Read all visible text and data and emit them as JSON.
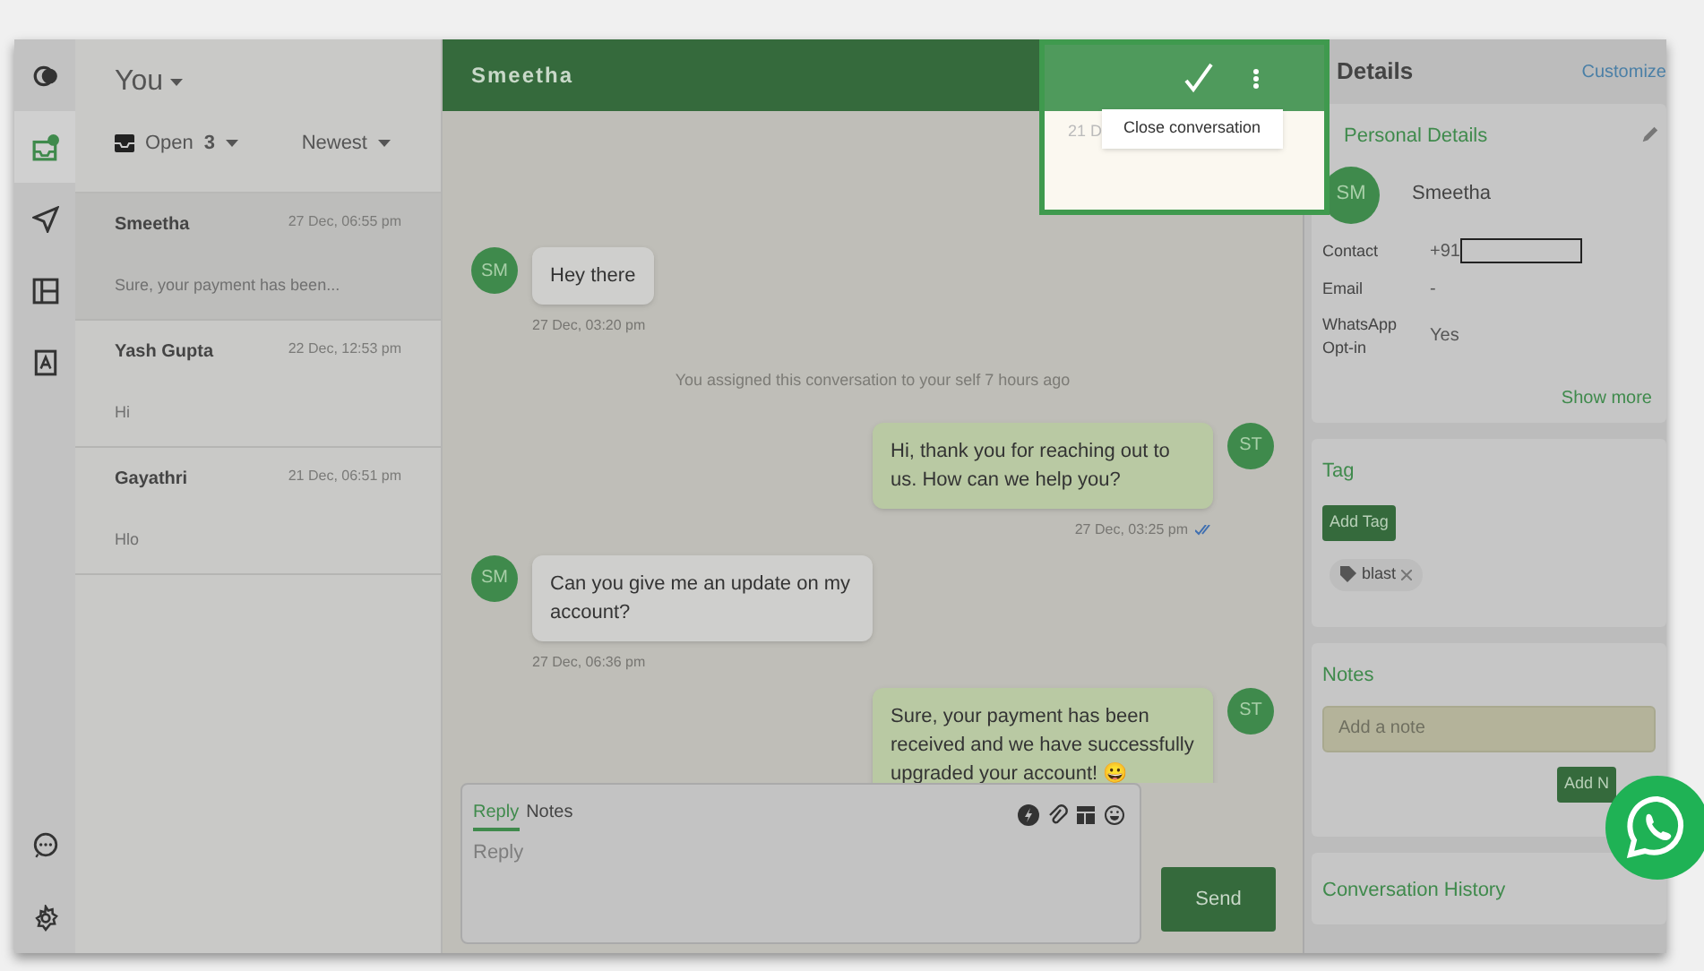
{
  "rail": {
    "items": [
      {
        "selected": false
      },
      {
        "selected": true
      },
      {
        "selected": false
      },
      {
        "selected": false
      },
      {
        "selected": false
      }
    ]
  },
  "list": {
    "owner": "You",
    "filter": {
      "label": "Open",
      "count": "3"
    },
    "sort": "Newest",
    "conversations": [
      {
        "name": "Smeetha",
        "time": "27 Dec, 06:55 pm",
        "preview": "Sure, your payment has been...",
        "selected": true
      },
      {
        "name": "Yash Gupta",
        "time": "22 Dec, 12:53 pm",
        "preview": "Hi",
        "selected": false
      },
      {
        "name": "Gayathri",
        "time": "21 Dec, 06:51 pm",
        "preview": "Hlo",
        "selected": false
      }
    ]
  },
  "chat": {
    "title": "Smeetha",
    "messages": [
      {
        "kind": "incoming",
        "avatar": "SM",
        "text": "Hey there",
        "time": "27 Dec, 03:20 pm"
      },
      {
        "kind": "system",
        "text": "You assigned this conversation to your self 7 hours ago"
      },
      {
        "kind": "outgoing",
        "avatar": "ST",
        "text": "Hi, thank you for reaching out to us. How can we help you?",
        "time": "27 Dec, 03:25 pm",
        "read": true
      },
      {
        "kind": "incoming",
        "avatar": "SM",
        "text": "Can you give me an update on my account?",
        "time": "27 Dec, 06:36 pm"
      },
      {
        "kind": "outgoing",
        "avatar": "ST",
        "text": "Sure, your payment has been received and we have successfully upgraded your account! 😀"
      }
    ]
  },
  "spotlight": {
    "tooltip": "Close conversation",
    "behind_text": "21 D"
  },
  "composer": {
    "tabs": [
      {
        "label": "Reply",
        "selected": true
      },
      {
        "label": "Notes",
        "selected": false
      }
    ],
    "placeholder": "Reply",
    "send": "Send"
  },
  "details": {
    "title": "Details",
    "customize": "Customize",
    "personal": {
      "title": "Personal Details",
      "avatar": "SM",
      "name": "Smeetha",
      "fields": [
        {
          "label": "Contact",
          "value": "+91",
          "redacted": true
        },
        {
          "label": "Email",
          "value": "-"
        },
        {
          "label": "WhatsApp Opt-in",
          "value": "Yes"
        }
      ],
      "more": "Show more"
    },
    "tag": {
      "title": "Tag",
      "button": "Add Tag",
      "tags": [
        {
          "label": "blast"
        }
      ]
    },
    "notes": {
      "title": "Notes",
      "placeholder": "Add a note",
      "button": "Add N"
    },
    "history": {
      "title": "Conversation History"
    }
  }
}
